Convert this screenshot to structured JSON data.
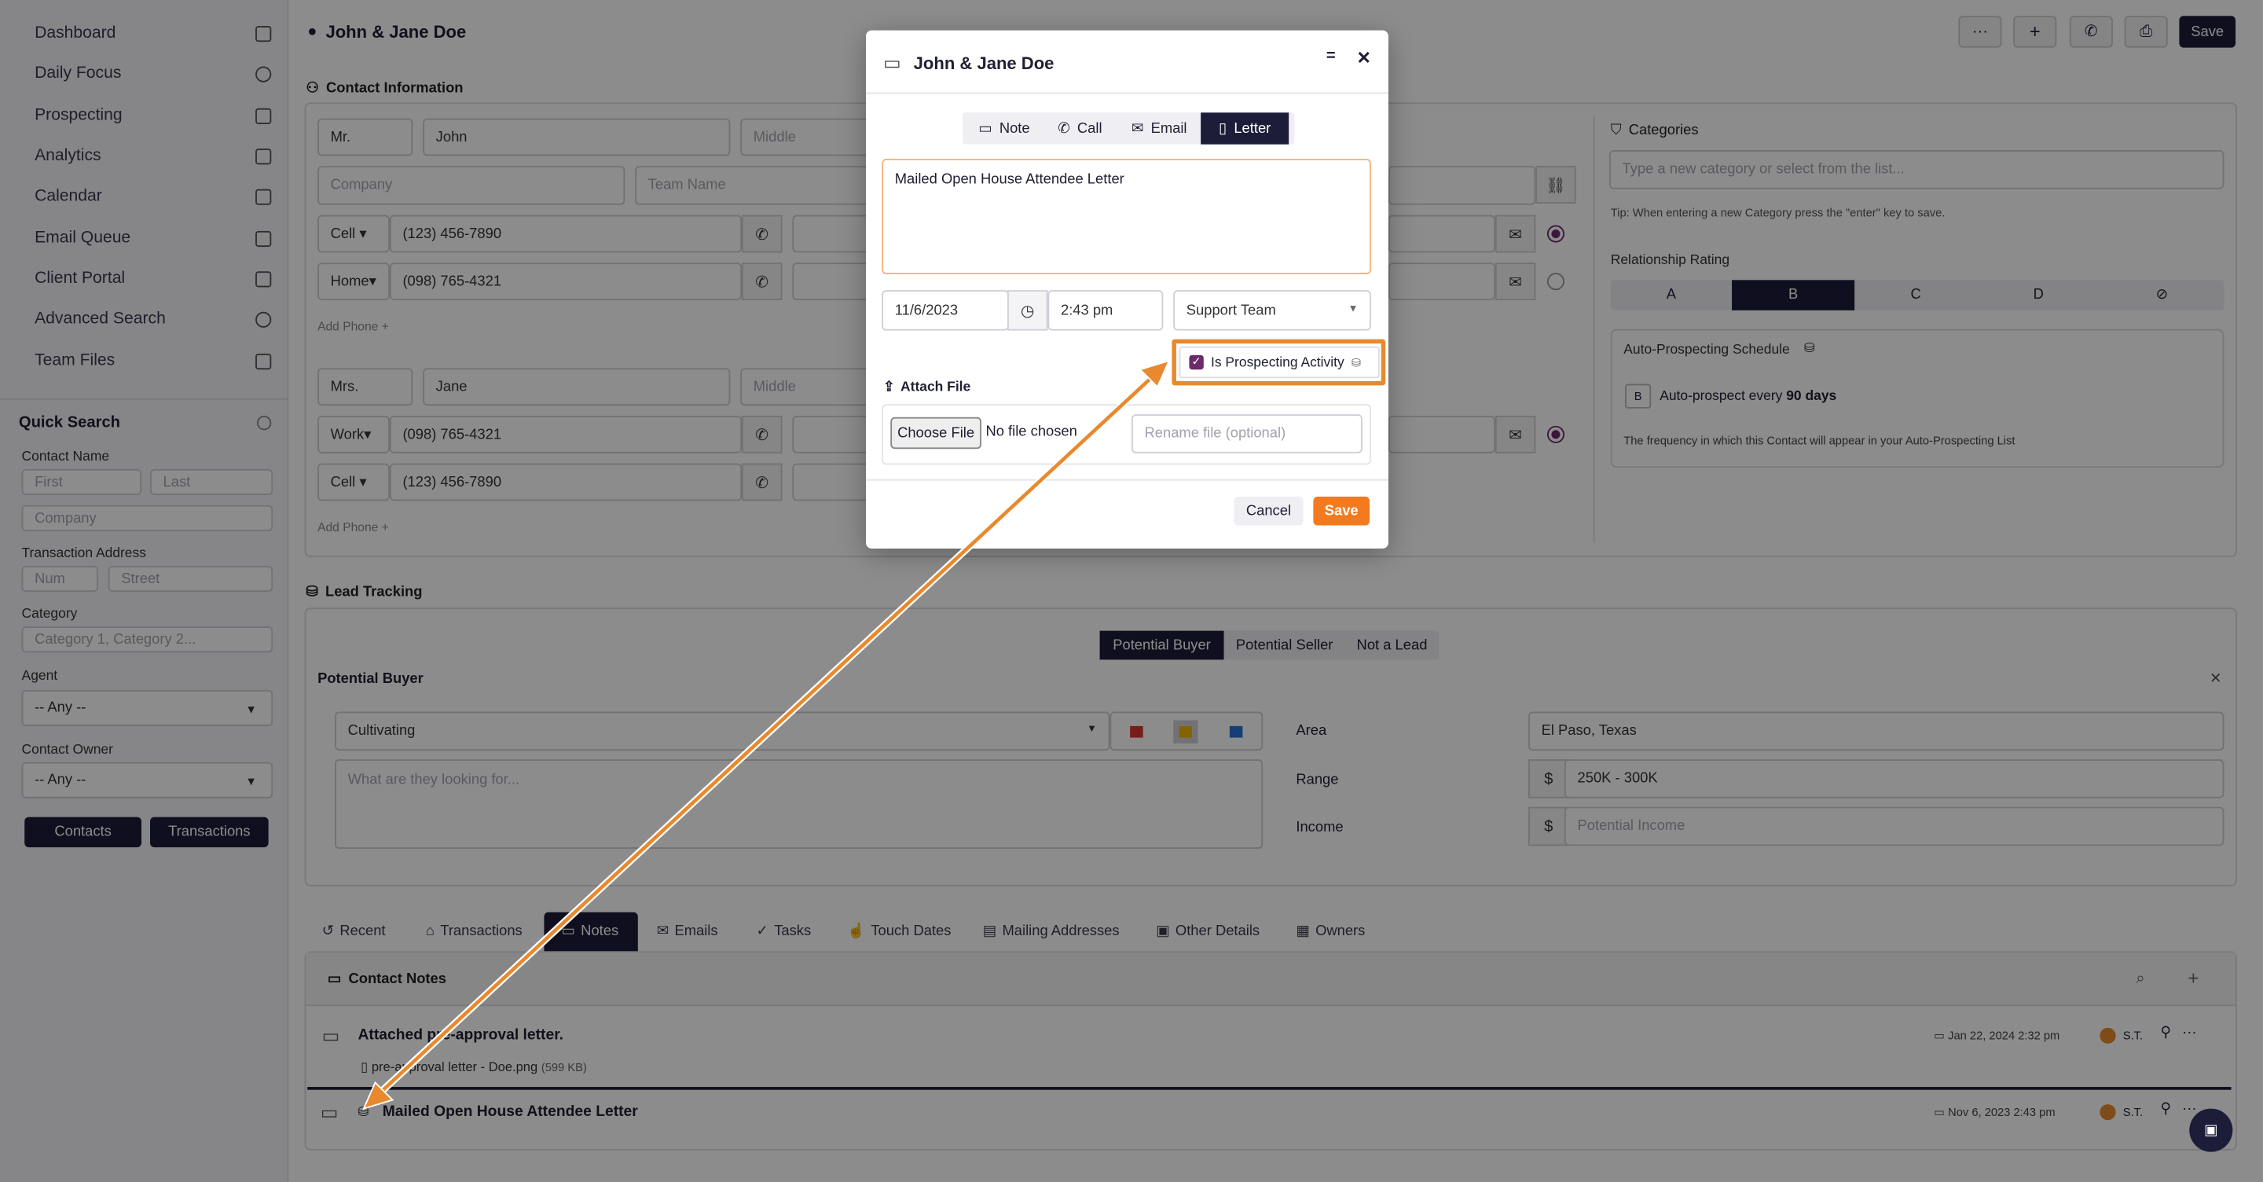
{
  "sidebar": {
    "items": [
      {
        "label": "Dashboard",
        "icon": "grid-icon"
      },
      {
        "label": "Daily Focus",
        "icon": "target-icon"
      },
      {
        "label": "Prospecting",
        "icon": "money-bag-icon"
      },
      {
        "label": "Analytics",
        "icon": "chart-icon"
      },
      {
        "label": "Calendar",
        "icon": "calendar-icon"
      },
      {
        "label": "Email Queue",
        "icon": "email-queue-icon"
      },
      {
        "label": "Client Portal",
        "icon": "portal-icon"
      },
      {
        "label": "Advanced Search",
        "icon": "search-icon"
      },
      {
        "label": "Team Files",
        "icon": "file-icon"
      }
    ],
    "quick_search": {
      "title": "Quick Search",
      "contact_name_label": "Contact Name",
      "first_ph": "First",
      "last_ph": "Last",
      "company_ph": "Company",
      "transaction_address_label": "Transaction Address",
      "num_ph": "Num",
      "street_ph": "Street",
      "category_label": "Category",
      "category_ph": "Category 1, Category 2...",
      "agent_label": "Agent",
      "agent_value": "-- Any --",
      "owner_label": "Contact Owner",
      "owner_value": "-- Any --",
      "contacts_btn": "Contacts",
      "transactions_btn": "Transactions"
    }
  },
  "header": {
    "title": "John & Jane Doe",
    "save_label": "Save"
  },
  "contact_info": {
    "title": "Contact Information",
    "p1": {
      "prefix": "Mr.",
      "first": "John",
      "middle_ph": "Middle"
    },
    "company_ph": "Company",
    "team_ph": "Team Name",
    "phones1": [
      {
        "type": "Cell",
        "number": "(123) 456-7890"
      },
      {
        "type": "Home",
        "number": "(098) 765-4321"
      }
    ],
    "add_phone": "Add Phone +",
    "p2": {
      "prefix": "Mrs.",
      "first": "Jane",
      "middle_ph": "Middle"
    },
    "phones2": [
      {
        "type": "Work",
        "number": "(098) 765-4321"
      },
      {
        "type": "Cell",
        "number": "(123) 456-7890"
      }
    ]
  },
  "categories": {
    "title": "Categories",
    "placeholder": "Type a new category or select from the list...",
    "tip": "Tip: When entering a new Category press the \"enter\" key to save.",
    "rating_label": "Relationship Rating",
    "ratings": [
      "A",
      "B",
      "C",
      "D"
    ],
    "selected_rating": "B",
    "auto_title": "Auto-Prospecting Schedule",
    "auto_badge": "B",
    "auto_text": "Auto-prospect every",
    "auto_days": "90 days",
    "auto_desc": "The frequency in which this Contact will appear in your Auto-Prospecting List"
  },
  "lead": {
    "title": "Lead Tracking",
    "tabs": [
      "Potential Buyer",
      "Potential Seller",
      "Not a Lead"
    ],
    "active_tab": "Potential Buyer",
    "subtitle": "Potential Buyer",
    "status": "Cultivating",
    "looking_ph": "What are they looking for...",
    "area_label": "Area",
    "area": "El Paso, Texas",
    "range_label": "Range",
    "range": "250K - 300K",
    "income_label": "Income",
    "income_ph": "Potential Income",
    "currency": "$",
    "flag_colors": {
      "red": "#d9352b",
      "yellow": "#f0b400",
      "blue": "#2b6fd9"
    }
  },
  "bottom_tabs": [
    "Recent",
    "Transactions",
    "Notes",
    "Emails",
    "Tasks",
    "Touch Dates",
    "Mailing Addresses",
    "Other Details",
    "Owners"
  ],
  "active_bottom_tab": "Notes",
  "notes": {
    "title": "Contact Notes",
    "items": [
      {
        "title": "Attached pre-approval letter.",
        "attachment": "pre-approval letter - Doe.png",
        "size": "(599 KB)",
        "date": "Jan 22, 2024 2:32 pm",
        "user": "S.T."
      },
      {
        "title": "Mailed Open House Attendee Letter",
        "date": "Nov 6, 2023 2:43 pm",
        "user": "S.T."
      }
    ]
  },
  "modal": {
    "title": "John & Jane Doe",
    "tabs": [
      "Note",
      "Call",
      "Email",
      "Letter"
    ],
    "active_tab": "Letter",
    "body": "Mailed Open House Attendee Letter",
    "date": "11/6/2023",
    "time": "2:43 pm",
    "team": "Support Team",
    "prospecting_label": "Is Prospecting Activity",
    "attach_title": "Attach File",
    "choose_file": "Choose File",
    "no_file": "No file chosen",
    "rename_ph": "Rename file (optional)",
    "cancel": "Cancel",
    "save": "Save"
  },
  "colors": {
    "accent": "#f47a1f",
    "dark": "#1d1d3a",
    "highlight": "#e8892d"
  }
}
